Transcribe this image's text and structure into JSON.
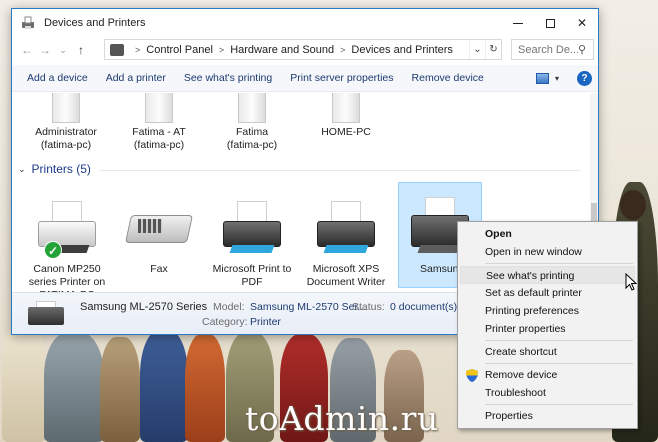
{
  "window": {
    "title": "Devices and Printers",
    "buttons": {
      "minimize": "",
      "maximize": "",
      "close": "✕"
    }
  },
  "nav": {
    "back": "←",
    "forward": "→",
    "recent": "⌄",
    "up": "↑"
  },
  "address": {
    "crumbs": [
      "Control Panel",
      "Hardware and Sound",
      "Devices and Printers"
    ],
    "dropdown": "⌄",
    "refresh": "↻"
  },
  "search": {
    "placeholder": "Search De...",
    "icon": "⚲"
  },
  "toolbar": {
    "items": [
      "Add a device",
      "Add a printer",
      "See what's printing",
      "Print server properties",
      "Remove device"
    ],
    "view_dropdown": "▾",
    "help": "?"
  },
  "devices": [
    {
      "line1": "Administrator",
      "line2": "(fatima-pc)"
    },
    {
      "line1": "Fatima - AT",
      "line2": "(fatima-pc)"
    },
    {
      "line1": "Fatima",
      "line2": "(fatima-pc)"
    },
    {
      "line1": "HOME-PC",
      "line2": ""
    }
  ],
  "printers_group": {
    "label": "Printers (5)",
    "chevron": "⌄"
  },
  "printers": [
    {
      "name": "Canon MP250 series Printer on FATIMA-PC",
      "default_check": "✓"
    },
    {
      "name": "Fax"
    },
    {
      "name": "Microsoft Print to PDF"
    },
    {
      "name": "Microsoft XPS Document Writer"
    },
    {
      "name": "Samsung ML-2570 Se"
    }
  ],
  "details": {
    "name": "Samsung ML-2570 Series",
    "model_label": "Model:",
    "model_value": "Samsung ML-2570 Ser...",
    "status_label": "Status:",
    "status_value": "0 document(s) i",
    "category_label": "Category:",
    "category_value": "Printer"
  },
  "context_menu": {
    "items": [
      {
        "label": "Open",
        "bold": true
      },
      {
        "label": "Open in new window"
      },
      {
        "label": "See what's printing",
        "hover": true
      },
      {
        "label": "Set as default printer"
      },
      {
        "label": "Printing preferences"
      },
      {
        "label": "Printer properties"
      },
      {
        "label": "Create shortcut"
      },
      {
        "label": "Remove device",
        "icon": "shield-icon"
      },
      {
        "label": "Troubleshoot"
      },
      {
        "label": "Properties"
      }
    ]
  },
  "watermark": "toAdmin.ru",
  "colors": {
    "accent": "#2b79c2",
    "link": "#1d3a6f",
    "selection": "#cce8ff",
    "check": "#24a338"
  }
}
